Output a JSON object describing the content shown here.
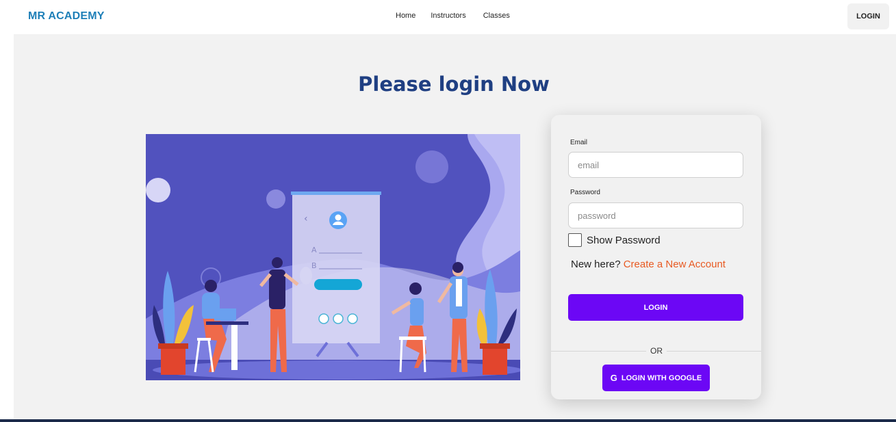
{
  "brand": "MR ACADEMY",
  "nav": {
    "links": [
      "Home",
      "Instructors",
      "Classes"
    ],
    "login_label": "LOGIN"
  },
  "page": {
    "title": "Please login Now"
  },
  "illustration": {
    "field_a": "A",
    "field_b": "B",
    "back_glyph": "‹"
  },
  "form": {
    "email_label": "Email",
    "email_placeholder": "email",
    "password_label": "Password",
    "password_placeholder": "password",
    "show_password_label": "Show Password",
    "new_here_text": "New here?",
    "create_account_link": "Create a New Account",
    "login_button": "LOGIN",
    "or_text": "OR",
    "google_button": "LOGIN WITH GOOGLE",
    "google_icon": "G"
  },
  "colors": {
    "brand": "#1e7fb8",
    "title": "#1f3f82",
    "primary_button": "#6c07f5",
    "link": "#e85a22",
    "illustration_bg": "#5152be"
  }
}
